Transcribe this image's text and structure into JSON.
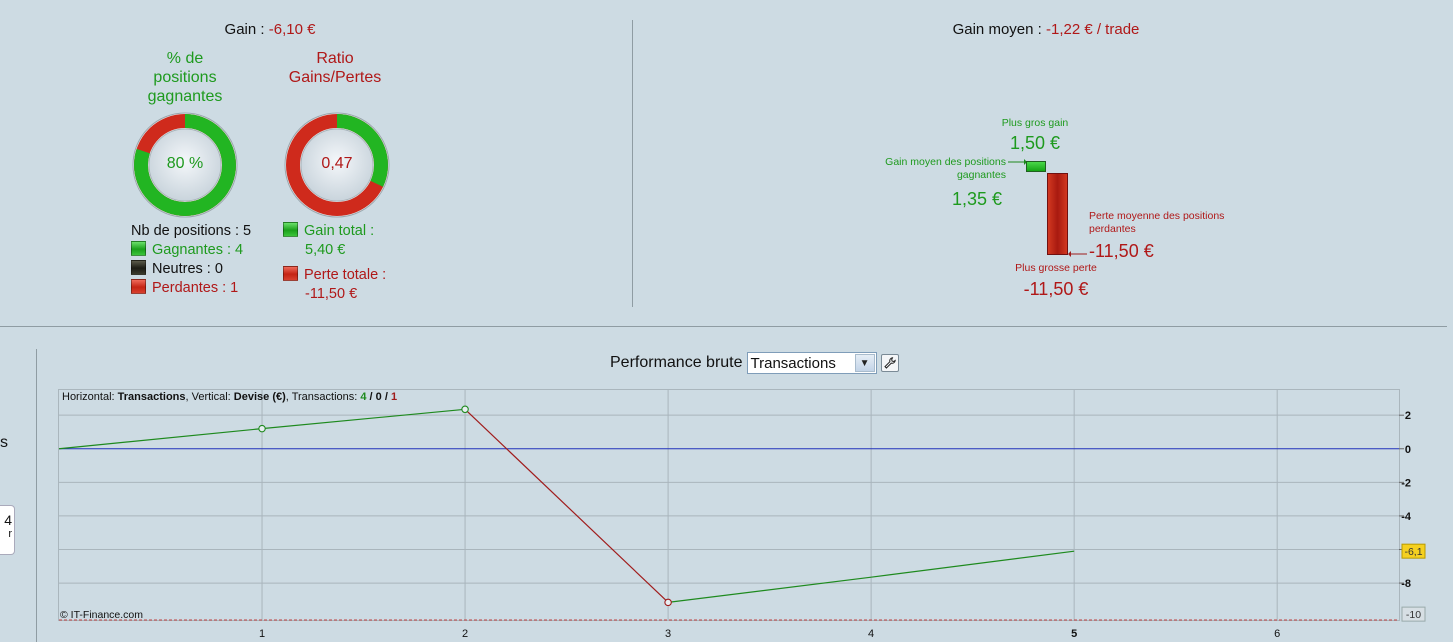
{
  "summary": {
    "gain_label": "Gain : ",
    "gain_value": "-6,10 €",
    "avg_gain_label": "Gain moyen : ",
    "avg_gain_value": "-1,22 € / trade",
    "winning_donut": {
      "title_line1": "% de",
      "title_line2": "positions",
      "title_line3": "gagnantes",
      "value": "80 %",
      "fraction": 0.8
    },
    "ratio_donut": {
      "title_line1": "Ratio",
      "title_line2": "Gains/Pertes",
      "value": "0,47",
      "fraction": 0.32
    },
    "positions": {
      "count_label": "Nb de positions : 5",
      "winning_label": "Gagnantes : 4",
      "neutral_label": "Neutres : 0",
      "losing_label": "Perdantes : 1"
    },
    "totals": {
      "gain_total_label": "Gain total :",
      "gain_total_value": "5,40 €",
      "loss_total_label": "Perte totale :",
      "loss_total_value": "-11,50 €"
    },
    "extremes": {
      "biggest_gain_label": "Plus gros gain",
      "biggest_gain_value": "1,50 €",
      "avg_win_label_1": "Gain moyen des positions",
      "avg_win_label_2": "gagnantes",
      "avg_win_value": "1,35 €",
      "avg_loss_label_1": "Perte moyenne des positions",
      "avg_loss_label_2": "perdantes",
      "avg_loss_value": "-11,50 €",
      "biggest_loss_label": "Plus grosse perte",
      "biggest_loss_value": "-11,50 €"
    }
  },
  "chart_header": {
    "label": "Performance brute",
    "select_value": "Transactions"
  },
  "chart_info": {
    "prefix": "Horizontal: ",
    "h_value": "Transactions",
    "mid": ", Vertical: ",
    "v_value": "Devise (€)",
    "tx_label": ", Transactions: ",
    "tx_win": "4",
    "sep1": " / ",
    "tx_neutral": "0",
    "sep2": " / ",
    "tx_loss": "1"
  },
  "copyright": "© IT-Finance.com",
  "left_stub": {
    "s": "s",
    "box_top": "4",
    "box_bottom": "r"
  },
  "chart_data": {
    "type": "line",
    "x": [
      0,
      1,
      2,
      3,
      4,
      5
    ],
    "y": [
      0,
      1.2,
      2.35,
      -9.15,
      -7.65,
      -6.1
    ],
    "segment_colors": [
      "green",
      "green",
      "red",
      "green",
      "green"
    ],
    "markers_at": [
      1,
      2,
      3
    ],
    "xlim": [
      0,
      6.6
    ],
    "ylim": [
      -10.2,
      3.5
    ],
    "x_ticks": [
      "1",
      "2",
      "3",
      "4",
      "5",
      "6"
    ],
    "y_ticks": [
      "2",
      "0",
      "-2",
      "-4",
      "-6",
      "-8"
    ],
    "current_value_badge": "-6,1",
    "min_value_badge": "-10",
    "zero_line": true,
    "grid": true,
    "axis_side": "right"
  },
  "colors": {
    "green": "#1e8a1e",
    "red": "#a01c1c",
    "zero_line": "#2233bb",
    "badge": "#f5d020"
  }
}
